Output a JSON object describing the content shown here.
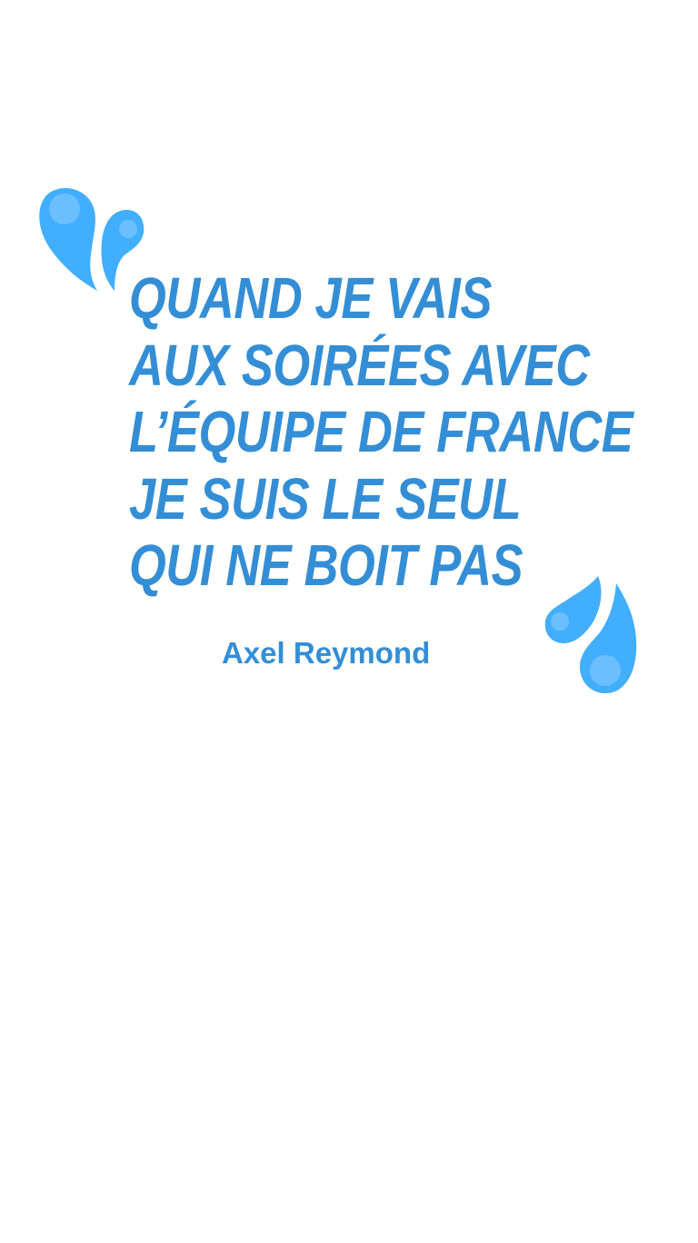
{
  "quote": {
    "lines": [
      "QUAND JE VAIS",
      "AUX SOIRÉES AVEC",
      "L’ÉQUIPE DE FRANCE",
      "JE SUIS LE SEUL",
      "QUI NE BOIT PAS"
    ],
    "author": "Axel Reymond"
  },
  "colors": {
    "text": "#338ed6",
    "drop": "#42aeff",
    "drop_highlight": "#6cbfff"
  },
  "icons": [
    "open-quote-drops-icon",
    "close-quote-drops-icon"
  ]
}
